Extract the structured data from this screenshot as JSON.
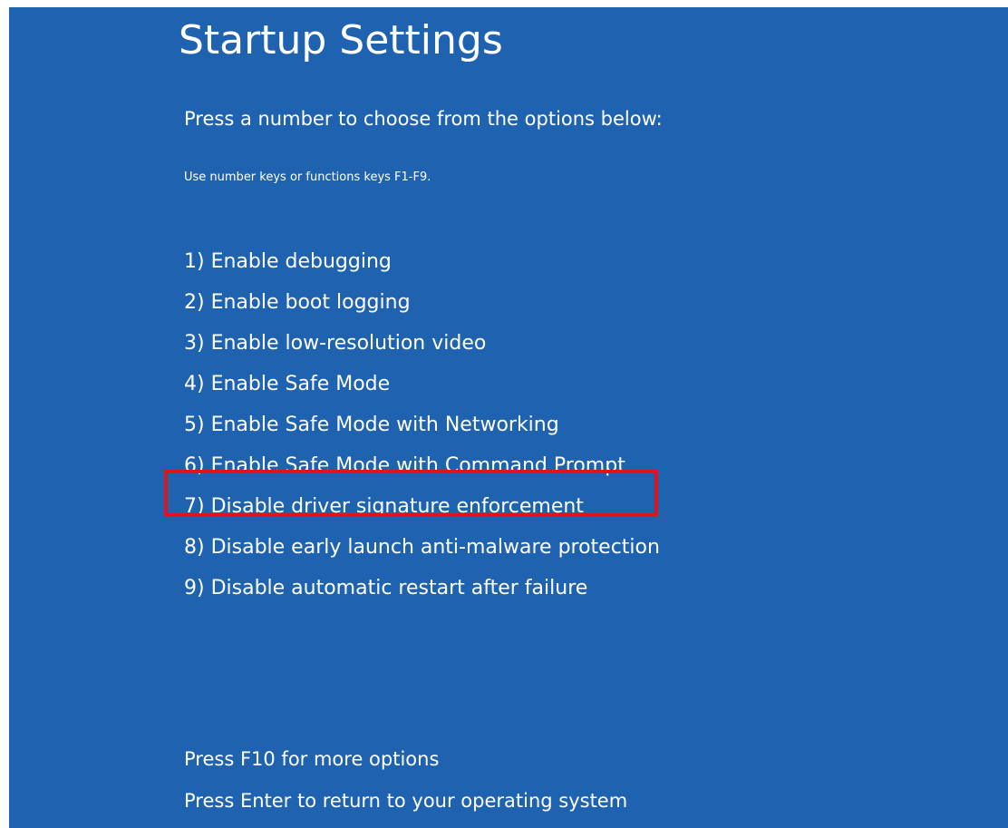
{
  "screen": {
    "title": "Startup Settings",
    "prompt": "Press a number to choose from the options below:",
    "hint": "Use number keys or functions keys F1-F9.",
    "background_color": "#1f63b0",
    "highlight_color": "#e0141e"
  },
  "options": [
    {
      "label": "1) Enable debugging"
    },
    {
      "label": "2) Enable boot logging"
    },
    {
      "label": "3) Enable low-resolution video"
    },
    {
      "label": "4) Enable Safe Mode"
    },
    {
      "label": "5) Enable Safe Mode with Networking"
    },
    {
      "label": "6) Enable Safe Mode with Command Prompt"
    },
    {
      "label": "7) Disable driver signature enforcement",
      "highlighted": true
    },
    {
      "label": "8) Disable early launch anti-malware protection"
    },
    {
      "label": "9) Disable automatic restart after failure"
    }
  ],
  "footer": {
    "more_options": "Press F10 for more options",
    "return_to_os": "Press Enter to return to your operating system"
  }
}
